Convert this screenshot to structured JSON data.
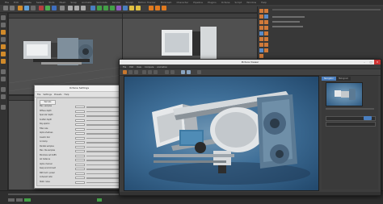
{
  "app": {
    "menu_items": [
      "File",
      "Edit",
      "Create",
      "Select",
      "Tools",
      "Mesh",
      "Snap",
      "Animate",
      "Simulate",
      "Render",
      "Sculpt",
      "Motion Tracker",
      "MoGraph",
      "Character",
      "Pipeline",
      "Plugins",
      "Octane",
      "Script",
      "Window",
      "Help"
    ]
  },
  "octane": {
    "title": "Octane Settings",
    "menu": [
      "File",
      "Settings",
      "Presets",
      "Help"
    ],
    "tab": "Kernels",
    "rows": [
      "Max. samples",
      "Diffuse depth",
      "Specular depth",
      "Scatter depth",
      "Ray epsilon",
      "Filter size",
      "Alpha shadows",
      "Caustic blur",
      "GI clamp",
      "Parallel samples",
      "Max. tile samples",
      "Minimize net traffic",
      "AO distance",
      "Alpha channel",
      "Keep environment",
      "Path term. power",
      "Coherent ratio",
      "Static noise"
    ]
  },
  "picture_viewer": {
    "title": "Picture Viewer",
    "menu": [
      "File",
      "Edit",
      "View",
      "Compare",
      "Animation"
    ],
    "tabs": [
      "Navigator",
      "Histogram"
    ],
    "window_controls": [
      "–",
      "□",
      "✕"
    ]
  },
  "colors": {
    "accent_orange": "#e07a1f",
    "accent_blue": "#4a7fc0",
    "accent_green": "#43a047",
    "canvas_blue": "#3f6f98"
  }
}
